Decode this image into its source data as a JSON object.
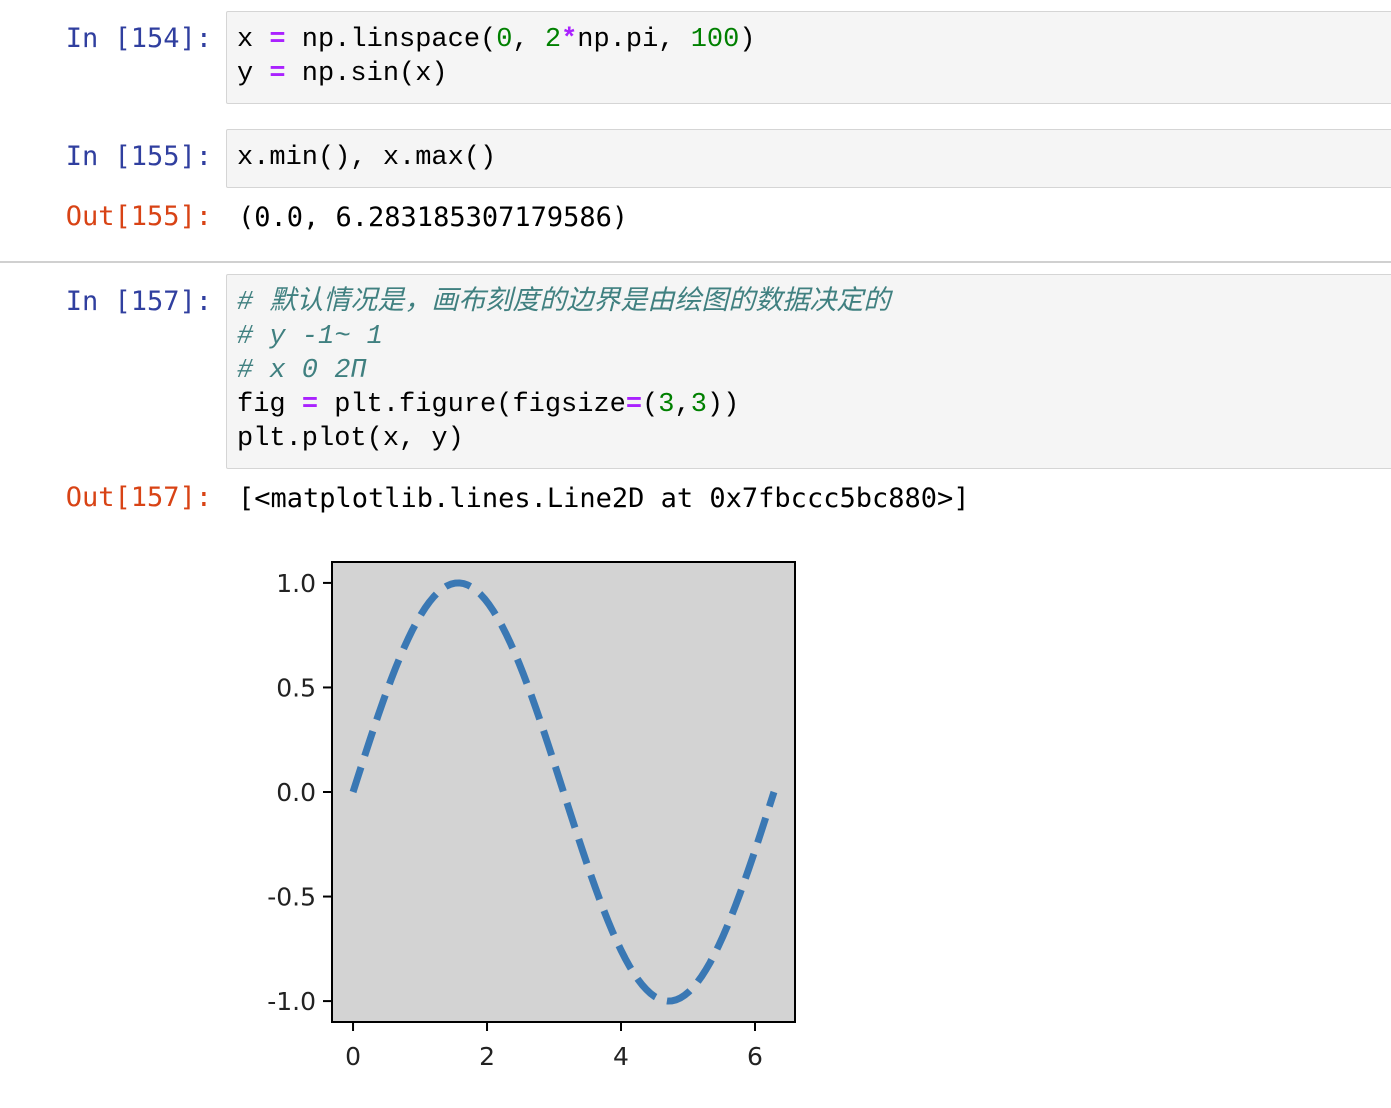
{
  "cells": [
    {
      "in_prompt": "In [154]:",
      "code_lines": [
        "x = np.linspace(0, 2*np.pi, 100)",
        "y = np.sin(x)"
      ]
    },
    {
      "in_prompt": "In [155]:",
      "code_lines": [
        "x.min(), x.max()"
      ],
      "out_prompt": "Out[155]:",
      "output_text": "(0.0, 6.283185307179586)"
    },
    {
      "in_prompt": "In [157]:",
      "code_lines": [
        "# 默认情况是，画布刻度的边界是由绘图的数据决定的",
        "# y -1~ 1",
        "# x 0 2Π",
        "fig = plt.figure(figsize=(3,3))",
        "plt.plot(x, y)"
      ],
      "out_prompt": "Out[157]:",
      "output_text": "[<matplotlib.lines.Line2D at 0x7fbccc5bc880>]"
    }
  ],
  "colors": {
    "in_prompt": "#303f9f",
    "out_prompt": "#d84315",
    "line": "#3a78b4",
    "axes_face": "#d3d3d3"
  },
  "chart_data": {
    "type": "line",
    "function": "y = sin(x)",
    "x_start": 0,
    "x_end": 6.283185307179586,
    "num_points": 100,
    "line_style": "dashed",
    "line_color": "#3a78b4",
    "axes_facecolor": "#d3d3d3",
    "xlim": [
      -0.314,
      6.597
    ],
    "ylim": [
      -1.1,
      1.1
    ],
    "xticks": [
      0,
      2,
      4,
      6
    ],
    "xtick_labels": [
      "0",
      "2",
      "4",
      "6"
    ],
    "yticks": [
      1.0,
      0.5,
      0.0,
      -0.5,
      -1.0
    ],
    "ytick_labels": [
      "1.0",
      "0.5",
      "0.0",
      "-0.5",
      "-1.0"
    ],
    "grid": false
  }
}
